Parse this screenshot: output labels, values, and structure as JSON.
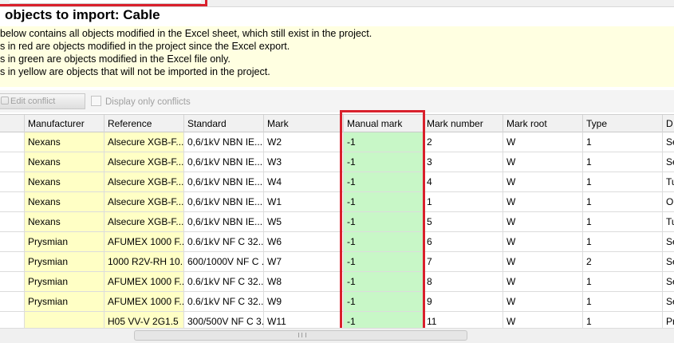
{
  "dialog": {
    "title": "objects to import: Cable"
  },
  "info": {
    "lines": [
      "below contains all objects modified in the Excel sheet, which still exist in the project.",
      "s in red are objects modified in the project since the Excel export.",
      "s in green are objects modified in the Excel file only.",
      "s in yellow are objects that will not be imported in the project."
    ],
    "background": "#ffffe1"
  },
  "toolbar": {
    "edit_conflict_label": "Edit conflict",
    "display_only_conflicts_label": "Display only conflicts",
    "display_only_conflicts_checked": false
  },
  "table": {
    "columns": [
      "Manufacturer",
      "Reference",
      "Standard",
      "Mark",
      "Manual mark",
      "Mark number",
      "Mark root",
      "Type",
      "D"
    ],
    "rows": [
      {
        "manufacturer": "Nexans",
        "reference": "Alsecure XGB-F...",
        "standard": "0,6/1kV NBN IE...",
        "mark": "W2",
        "manual_mark": "-1",
        "mark_number": "2",
        "mark_root": "W",
        "type": "1",
        "d": "Se"
      },
      {
        "manufacturer": "Nexans",
        "reference": "Alsecure XGB-F...",
        "standard": "0,6/1kV NBN IE...",
        "mark": "W3",
        "manual_mark": "-1",
        "mark_number": "3",
        "mark_root": "W",
        "type": "1",
        "d": "Se"
      },
      {
        "manufacturer": "Nexans",
        "reference": "Alsecure XGB-F...",
        "standard": "0,6/1kV NBN IE...",
        "mark": "W4",
        "manual_mark": "-1",
        "mark_number": "4",
        "mark_root": "W",
        "type": "1",
        "d": "Tu"
      },
      {
        "manufacturer": "Nexans",
        "reference": "Alsecure XGB-F...",
        "standard": "0,6/1kV NBN IE...",
        "mark": "W1",
        "manual_mark": "-1",
        "mark_number": "1",
        "mark_root": "W",
        "type": "1",
        "d": "Oi"
      },
      {
        "manufacturer": "Nexans",
        "reference": "Alsecure XGB-F...",
        "standard": "0,6/1kV NBN IE...",
        "mark": "W5",
        "manual_mark": "-1",
        "mark_number": "5",
        "mark_root": "W",
        "type": "1",
        "d": "Tu"
      },
      {
        "manufacturer": "Prysmian",
        "reference": "AFUMEX 1000 F...",
        "standard": "0.6/1kV NF C 32...",
        "mark": "W6",
        "manual_mark": "-1",
        "mark_number": "6",
        "mark_root": "W",
        "type": "1",
        "d": "Se"
      },
      {
        "manufacturer": "Prysmian",
        "reference": "1000 R2V-RH 10...",
        "standard": "600/1000V NF C ...",
        "mark": "W7",
        "manual_mark": "-1",
        "mark_number": "7",
        "mark_root": "W",
        "type": "2",
        "d": "Se"
      },
      {
        "manufacturer": "Prysmian",
        "reference": "AFUMEX 1000 F...",
        "standard": "0.6/1kV NF C 32...",
        "mark": "W8",
        "manual_mark": "-1",
        "mark_number": "8",
        "mark_root": "W",
        "type": "1",
        "d": "Se"
      },
      {
        "manufacturer": "Prysmian",
        "reference": "AFUMEX 1000 F...",
        "standard": "0.6/1kV NF C 32...",
        "mark": "W9",
        "manual_mark": "-1",
        "mark_number": "9",
        "mark_root": "W",
        "type": "1",
        "d": "Se"
      },
      {
        "manufacturer": "",
        "reference": "H05 VV-V 2G1.5",
        "standard": "300/500V NF C 3...",
        "mark": "W11",
        "manual_mark": "-1",
        "mark_number": "11",
        "mark_root": "W",
        "type": "1",
        "d": "Pr"
      }
    ]
  },
  "colors": {
    "highlight_outline": "#d9202c",
    "yellow_cell": "#ffffc5",
    "green_cell": "#c8f7c7"
  }
}
